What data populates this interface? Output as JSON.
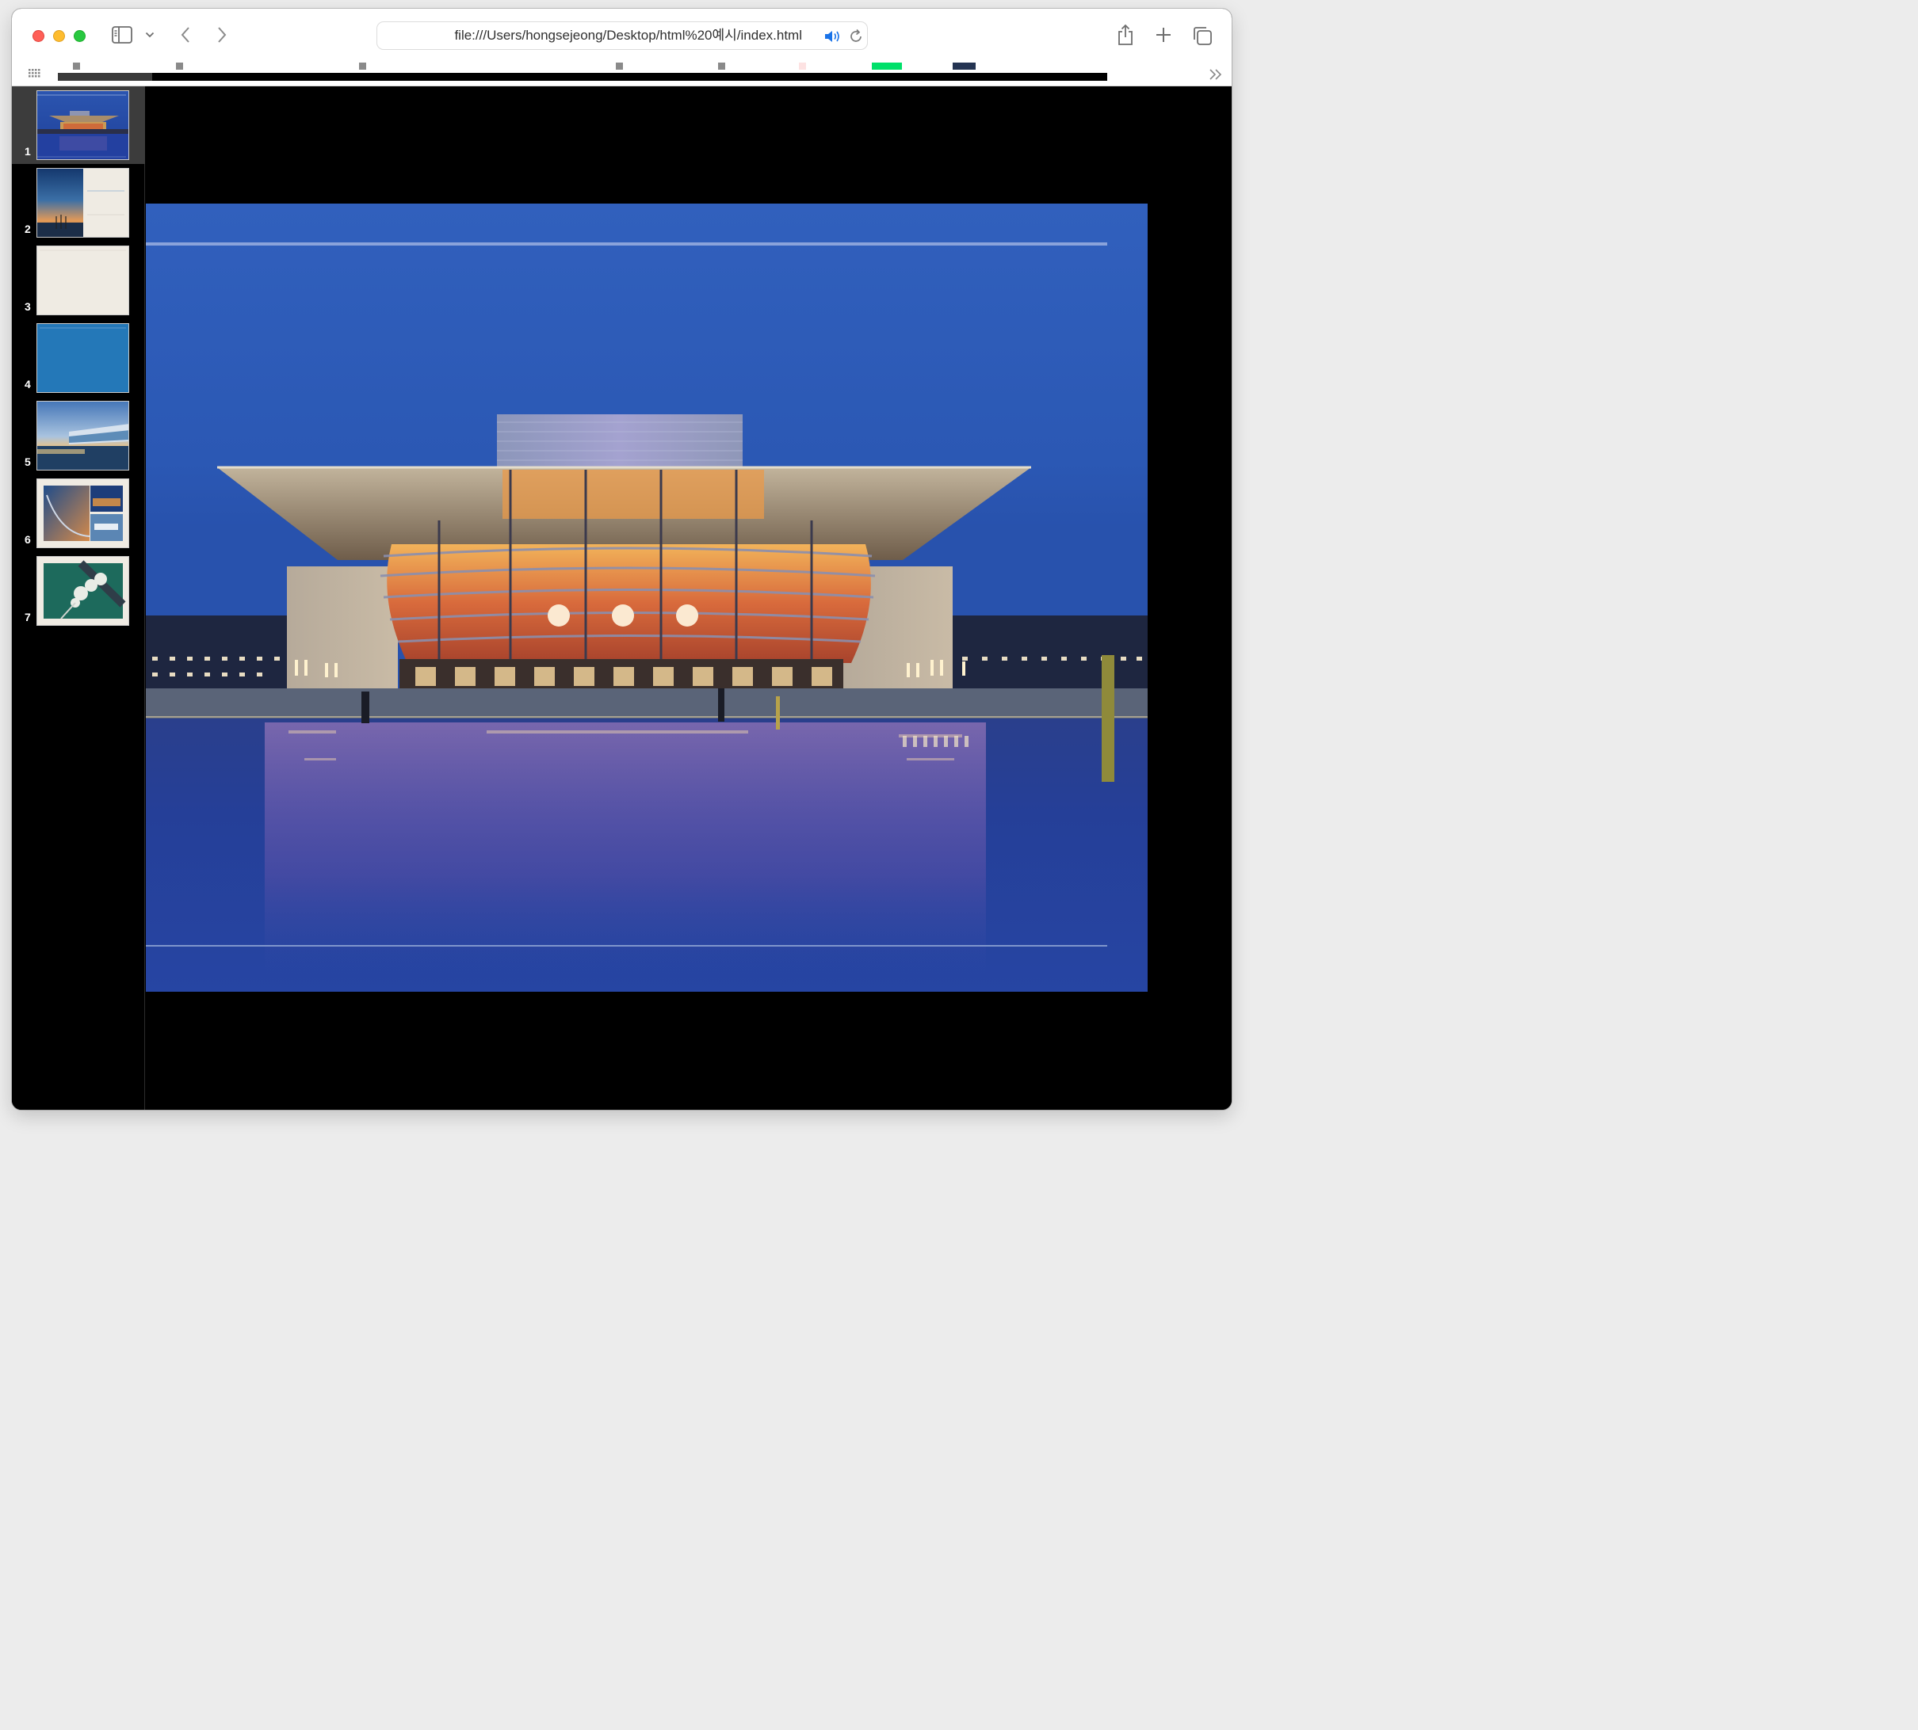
{
  "browser": {
    "url": "file:///Users/hongsejeong/Desktop/html%20예시/index.html"
  },
  "toolbar": {
    "icons": [
      "sidebar-icon",
      "chevron-down-icon",
      "back-arrow-icon",
      "forward-arrow-icon",
      "share-icon",
      "plus-icon",
      "tabs-overview-icon",
      "speaker-icon",
      "reload-icon"
    ]
  },
  "favorites": {
    "items": [
      {
        "color": "#8a8a8a"
      },
      {
        "color": "#8a8a8a"
      },
      {
        "color": "#8a8a8a"
      },
      {
        "color": "#8a8a8a"
      },
      {
        "color": "#8a8a8a"
      },
      {
        "color": "#fde2e2"
      },
      {
        "color": "#00e06a"
      },
      {
        "color": "#243452"
      }
    ],
    "progress": 0.09
  },
  "slides": {
    "selected": 1,
    "items": [
      {
        "number": "1"
      },
      {
        "number": "2"
      },
      {
        "number": "3"
      },
      {
        "number": "4"
      },
      {
        "number": "5"
      },
      {
        "number": "6"
      },
      {
        "number": "7"
      }
    ]
  },
  "colors": {
    "sky": "#2f5bb5",
    "water": "#1f3a96",
    "slide_bg": "#000000",
    "beige": "#efebe3",
    "teal_blue": "#2478b8"
  }
}
